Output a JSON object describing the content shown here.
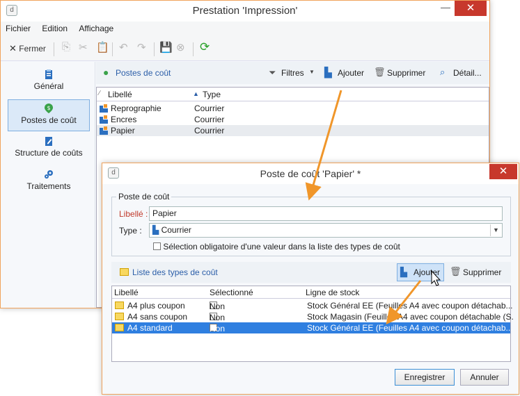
{
  "main": {
    "title": "Prestation 'Impression'",
    "menu": [
      "Fichier",
      "Edition",
      "Affichage"
    ],
    "toolbar": {
      "close_label": "Fermer"
    },
    "nav": [
      {
        "label": "Général",
        "icon": "clipboard-icon"
      },
      {
        "label": "Postes de coût",
        "icon": "money-pin-icon",
        "selected": true
      },
      {
        "label": "Structure de coûts",
        "icon": "pen-document-icon"
      },
      {
        "label": "Traitements",
        "icon": "gears-icon"
      }
    ],
    "subtoolbar": {
      "title": "Postes de coût",
      "filters": "Filtres",
      "add": "Ajouter",
      "delete": "Supprimer",
      "detail": "Détail..."
    },
    "grid": {
      "headers": {
        "label": "Libellé",
        "type": "Type"
      },
      "rows": [
        {
          "label": "Reprographie",
          "type": "Courrier"
        },
        {
          "label": "Encres",
          "type": "Courrier"
        },
        {
          "label": "Papier",
          "type": "Courrier"
        }
      ]
    }
  },
  "dialog": {
    "title": "Poste de coût 'Papier' *",
    "group_title": "Poste de coût",
    "label_caption": "Libellé :",
    "label_value": "Papier",
    "type_caption": "Type :",
    "type_value": "Courrier",
    "mandatory_checkbox": "Sélection obligatoire d'une valeur dans la liste des types de coût",
    "list_title": "Liste des types de coût",
    "add": "Ajouter",
    "delete": "Supprimer",
    "grid": {
      "headers": {
        "label": "Libellé",
        "selected": "Sélectionné",
        "stock": "Ligne de stock"
      },
      "rows": [
        {
          "label": "A4 plus coupon",
          "selected": "Non",
          "stock": "Stock Général EE (Feuilles A4 avec coupon détachab..."
        },
        {
          "label": "A4 sans coupon",
          "selected": "Non",
          "stock": "Stock Magasin (Feuilles A4 avec coupon détachable (S."
        },
        {
          "label": "A4 standard",
          "selected": "Non",
          "stock": "Stock Général EE (Feuilles A4 avec coupon détachab..."
        }
      ]
    },
    "save": "Enregistrer",
    "cancel": "Annuler"
  },
  "colors": {
    "accent_orange": "#f0962a",
    "selection_blue": "#2f7fe0",
    "close_red": "#c7382c",
    "label_red": "#c0392b"
  }
}
